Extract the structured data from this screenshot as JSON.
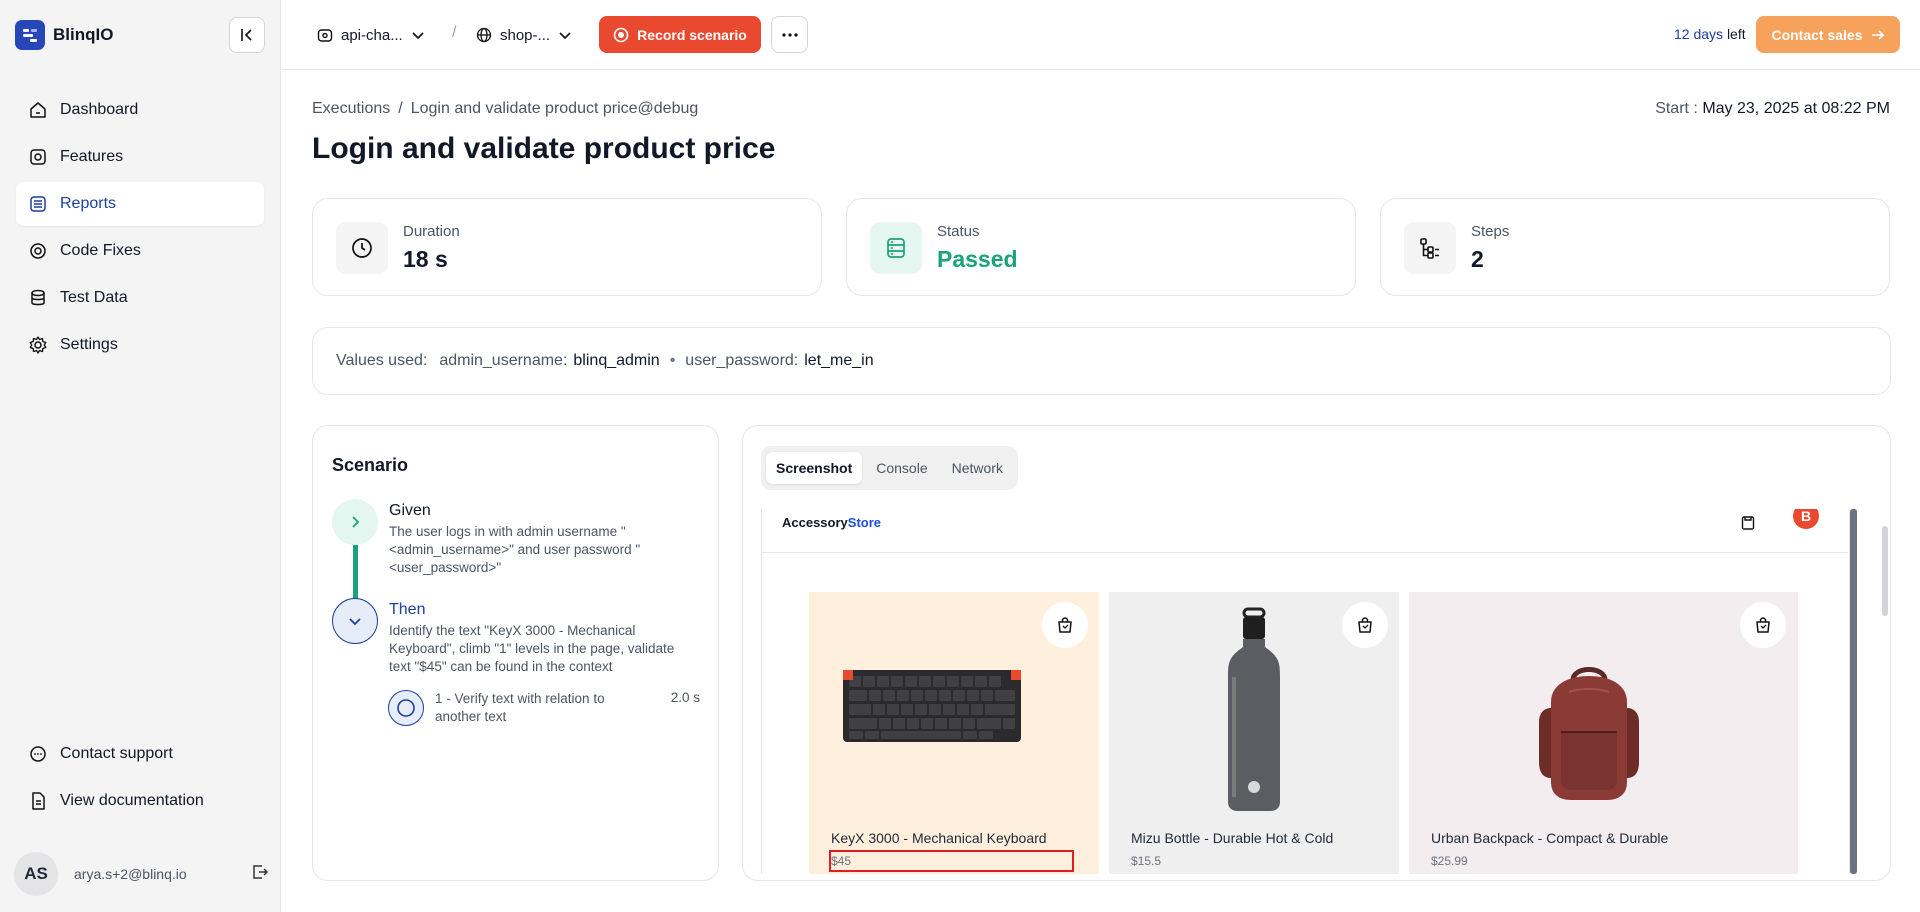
{
  "app": {
    "brand": "BlinqIO"
  },
  "sidebar": {
    "items": [
      {
        "label": "Dashboard",
        "icon": "home-icon",
        "active": false
      },
      {
        "label": "Features",
        "icon": "features-icon",
        "active": false
      },
      {
        "label": "Reports",
        "icon": "reports-icon",
        "active": true
      },
      {
        "label": "Code Fixes",
        "icon": "code-fixes-icon",
        "active": false
      },
      {
        "label": "Test Data",
        "icon": "database-icon",
        "active": false
      },
      {
        "label": "Settings",
        "icon": "gear-icon",
        "active": false
      }
    ],
    "bottom": [
      {
        "label": "Contact support",
        "icon": "chat-icon"
      },
      {
        "label": "View documentation",
        "icon": "document-icon"
      }
    ],
    "user": {
      "initials": "AS",
      "email": "arya.s+2@blinq.io"
    }
  },
  "topbar": {
    "project": "api-cha...",
    "environment": "shop-...",
    "record_label": "Record scenario",
    "trial_days": "12 days",
    "trial_suffix": "left",
    "contact_sales": "Contact sales"
  },
  "header": {
    "breadcrumb_root": "Executions",
    "breadcrumb_sep": "/",
    "breadcrumb_current": "Login and validate product price@debug",
    "start_label": "Start :",
    "start_value": "May 23, 2025 at 08:22 PM",
    "title": "Login and validate product price"
  },
  "stats": {
    "duration": {
      "label": "Duration",
      "value": "18 s"
    },
    "status": {
      "label": "Status",
      "value": "Passed"
    },
    "steps": {
      "label": "Steps",
      "value": "2"
    }
  },
  "values_used": {
    "label": "Values used:",
    "admin_key": "admin_username:",
    "admin_value": "blinq_admin",
    "sep": "•",
    "password_key": "user_password:",
    "password_value": "let_me_in"
  },
  "scenario": {
    "title": "Scenario",
    "given": {
      "keyword": "Given",
      "text": "The user logs in with admin username \"<admin_username>\" and user password \"<user_password>\""
    },
    "then": {
      "keyword": "Then",
      "text": "Identify the text \"KeyX 3000 - Mechanical Keyboard\", climb \"1\" levels in the page, validate text \"$45\" can be found in the context"
    },
    "substep": {
      "text": "1 - Verify text with relation to another text",
      "time": "2.0 s"
    }
  },
  "preview": {
    "tabs": [
      "Screenshot",
      "Console",
      "Network"
    ],
    "active_tab": "Screenshot",
    "store": {
      "name_a": "Accessory",
      "name_b": "Store",
      "avatar": "B"
    },
    "products": [
      {
        "name": "KeyX 3000 - Mechanical Keyboard",
        "price": "$45",
        "bg": "#ffefdc"
      },
      {
        "name": "Mizu Bottle - Durable Hot & Cold",
        "price": "$15.5",
        "bg": "#efefef"
      },
      {
        "name": "Urban Backpack - Compact & Durable",
        "price": "$25.99",
        "bg": "#f3edf0"
      }
    ]
  },
  "colors": {
    "brand": "#2746b8",
    "record": "#e8492f",
    "contact_sales": "#f7a25c",
    "passed": "#1aa37a",
    "highlight": "#e11d1d"
  }
}
